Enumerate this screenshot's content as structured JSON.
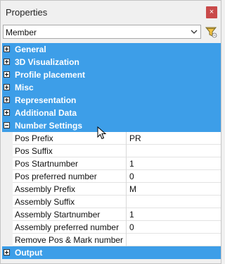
{
  "window": {
    "title": "Properties",
    "close_label": "×"
  },
  "toolbar": {
    "selected": "Member",
    "filter_icon": "filter-icon"
  },
  "categories_top": [
    {
      "label": "General",
      "expanded": false
    },
    {
      "label": "3D Visualization",
      "expanded": false
    },
    {
      "label": "Profile placement",
      "expanded": false
    },
    {
      "label": "Misc",
      "expanded": false
    },
    {
      "label": "Representation",
      "expanded": false
    },
    {
      "label": "Additional Data",
      "expanded": false
    },
    {
      "label": "Number Settings",
      "expanded": true
    }
  ],
  "properties": [
    {
      "name": "Pos Prefix",
      "value": "PR"
    },
    {
      "name": "Pos Suffix",
      "value": ""
    },
    {
      "name": "Pos Startnumber",
      "value": "1"
    },
    {
      "name": "Pos preferred number",
      "value": "0"
    },
    {
      "name": "Assembly Prefix",
      "value": "M"
    },
    {
      "name": "Assembly Suffix",
      "value": ""
    },
    {
      "name": "Assembly Startnumber",
      "value": "1"
    },
    {
      "name": "Assembly preferred number",
      "value": "0"
    },
    {
      "name": "Remove Pos & Mark number histo",
      "value": ""
    }
  ],
  "categories_bottom": [
    {
      "label": "Output",
      "expanded": false
    }
  ],
  "colors": {
    "category_bg": "#3d9ee8",
    "close_bg": "#c94a4a"
  }
}
